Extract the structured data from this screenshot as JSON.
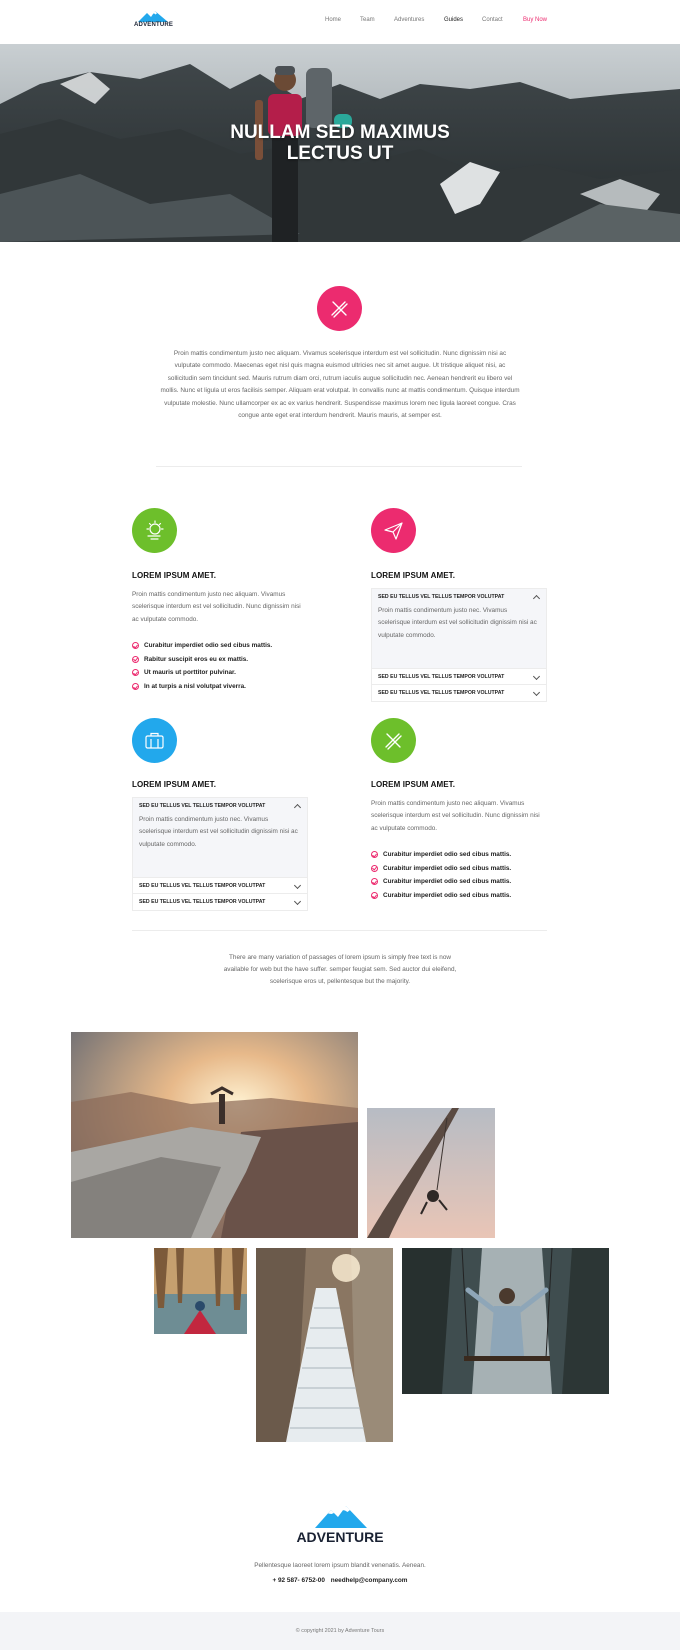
{
  "brand": {
    "name": "ADVENTURE",
    "accent": "#ec2b6f",
    "green": "#6dbf2b",
    "blue": "#22a8ec"
  },
  "nav": {
    "items": [
      {
        "label": "Home"
      },
      {
        "label": "Team"
      },
      {
        "label": "Adventures"
      },
      {
        "label": "Guides"
      },
      {
        "label": "Contact"
      }
    ],
    "active": "Guides",
    "cta": "Buy Now"
  },
  "hero": {
    "line1": "NULLAM SED MAXIMUS",
    "line2": "LECTUS UT"
  },
  "intro": {
    "icon": "pencil-ruler-icon",
    "text": "Proin mattis condimentum justo nec aliquam. Vivamus scelerisque interdum est vel sollicitudin. Nunc dignissim nisi ac vulputate commodo. Maecenas eget nisl quis magna euismod ultricies nec sit amet augue. Ut tristique aliquet nisi, ac sollicitudin sem tincidunt sed. Mauris rutrum diam orci, rutrum iaculis augue sollicitudin nec. Aenean hendrerit eu libero vel mollis. Nunc et ligula ut eros facilisis semper. Aliquam erat volutpat. In convallis nunc at mattis condimentum. Quisque interdum vulputate molestie. Nunc ullamcorper ex ac ex varius hendrerit. Suspendisse maximus lorem nec ligula laoreet congue. Cras congue ante eget erat interdum hendrerit. Mauris mauris, at semper est."
  },
  "features": [
    {
      "icon": "sun-cloud-icon",
      "title": "LOREM IPSUM AMET.",
      "text": "Proin mattis condimentum justo nec aliquam. Vivamus scelerisque interdum est vel sollicitudin. Nunc dignissim nisi ac vulputate commodo.",
      "list": [
        "Curabitur imperdiet odio sed cibus mattis.",
        "Rabitur suscipit eros eu ex mattis.",
        "Ut mauris ut porttitor pulvinar.",
        "In at turpis a nisl volutpat viverra."
      ]
    },
    {
      "icon": "paper-plane-icon",
      "title": "LOREM IPSUM AMET.",
      "accordion": [
        {
          "label": "SED EU  TELLUS VEL TELLUS TEMPOR VOLUTPAT",
          "body": "Proin mattis condimentum justo nec. Vivamus scelerisque interdum est vel sollicitudin dignissim nisi ac vulputate commodo."
        },
        {
          "label": "SED EU  TELLUS VEL TELLUS TEMPOR VOLUTPAT"
        },
        {
          "label": "SED EU  TELLUS VEL TELLUS TEMPOR VOLUTPAT"
        }
      ]
    },
    {
      "icon": "briefcase-icon",
      "title": "LOREM IPSUM AMET.",
      "accordion": [
        {
          "label": "SED EU  TELLUS VEL TELLUS TEMPOR VOLUTPAT",
          "body": "Proin mattis condimentum justo nec. Vivamus scelerisque interdum est vel sollicitudin dignissim nisi ac vulputate commodo."
        },
        {
          "label": "SED EU  TELLUS VEL TELLUS TEMPOR VOLUTPAT"
        },
        {
          "label": "SED EU  TELLUS VEL TELLUS TEMPOR VOLUTPAT"
        }
      ]
    },
    {
      "icon": "pencil-ruler-icon",
      "title": "LOREM IPSUM AMET.",
      "text": "Proin mattis condimentum justo nec aliquam. Vivamus scelerisque interdum est vel sollicitudin. Nunc dignissim nisi ac vulputate commodo.",
      "list": [
        "Curabitur imperdiet odio sed cibus mattis.",
        "Curabitur imperdiet odio sed cibus mattis.",
        "Curabitur imperdiet odio sed cibus mattis.",
        "Curabitur imperdiet odio sed cibus mattis."
      ]
    }
  ],
  "note": "There are many variation of passages of lorem ipsum is simply free text is now available for web but the have suffer. semper feugiat sem. Sed auctor dui eleifend, scelerisque eros ut, pellentesque but the majority.",
  "footer": {
    "brand": "ADVENTURE",
    "desc": "Pellentesque laoreet lorem ipsum blandit venenatis. Aenean.",
    "phone": "+ 92 587- 6752-00",
    "email": "needhelp@company.com",
    "copyright": "© copyright 2021 by Adventure Tours"
  }
}
